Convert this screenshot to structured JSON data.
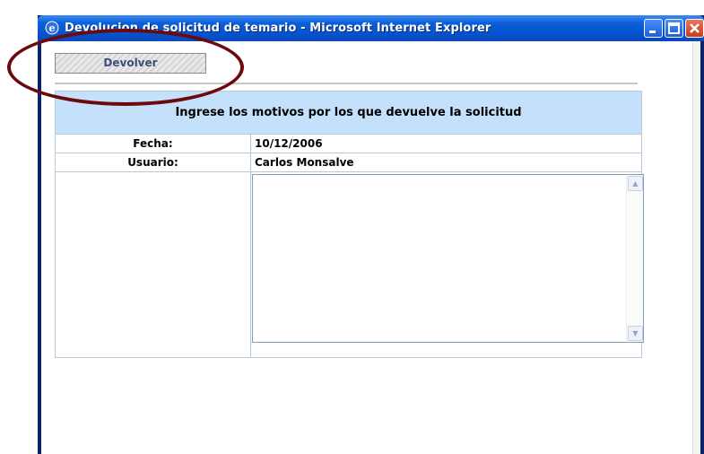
{
  "window": {
    "title": "Devolucion de solicitud de temario - Microsoft Internet Explorer"
  },
  "toolbar": {
    "devolver_label": "Devolver"
  },
  "form": {
    "heading": "Ingrese los motivos por los que devuelve la solicitud",
    "fecha_label": "Fecha:",
    "fecha_value": "10/12/2006",
    "usuario_label": "Usuario:",
    "usuario_value": "Carlos Monsalve",
    "motivos_value": ""
  },
  "icons": {
    "app": "internet-explorer-icon",
    "minimize": "minimize-icon",
    "maximize": "maximize-icon",
    "close": "close-icon",
    "scroll_up": "scroll-up-arrow-icon",
    "scroll_down": "scroll-down-arrow-icon"
  },
  "colors": {
    "titlebar": "#0553d0",
    "heading_bg": "#c4e0fb",
    "annotation_circle": "#6b0a0e",
    "button_text": "#3c4f7a"
  }
}
